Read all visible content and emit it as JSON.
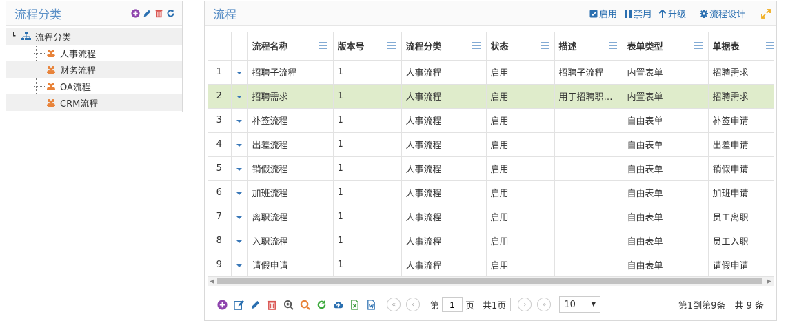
{
  "tree_panel": {
    "title": "流程分类",
    "root": {
      "label": "流程分类"
    },
    "items": [
      {
        "label": "人事流程"
      },
      {
        "label": "财务流程"
      },
      {
        "label": "OA流程"
      },
      {
        "label": "CRM流程"
      }
    ]
  },
  "grid_panel": {
    "title": "流程",
    "actions": {
      "enable": "启用",
      "disable": "禁用",
      "upgrade": "升级",
      "design": "流程设计"
    },
    "columns": [
      "流程名称",
      "版本号",
      "流程分类",
      "状态",
      "描述",
      "表单类型",
      "单据表"
    ],
    "rows": [
      {
        "num": "1",
        "name": "招聘子流程",
        "version": "1",
        "category": "人事流程",
        "status": "启用",
        "desc": "招聘子流程",
        "formtype": "内置表单",
        "table": "招聘需求"
      },
      {
        "num": "2",
        "name": "招聘需求",
        "version": "1",
        "category": "人事流程",
        "status": "启用",
        "desc": "用于招聘职位…",
        "formtype": "内置表单",
        "table": "招聘需求"
      },
      {
        "num": "3",
        "name": "补签流程",
        "version": "1",
        "category": "人事流程",
        "status": "启用",
        "desc": "",
        "formtype": "自由表单",
        "table": "补签申请"
      },
      {
        "num": "4",
        "name": "出差流程",
        "version": "1",
        "category": "人事流程",
        "status": "启用",
        "desc": "",
        "formtype": "自由表单",
        "table": "出差申请"
      },
      {
        "num": "5",
        "name": "销假流程",
        "version": "1",
        "category": "人事流程",
        "status": "启用",
        "desc": "",
        "formtype": "自由表单",
        "table": "销假申请"
      },
      {
        "num": "6",
        "name": "加班流程",
        "version": "1",
        "category": "人事流程",
        "status": "启用",
        "desc": "",
        "formtype": "自由表单",
        "table": "加班申请"
      },
      {
        "num": "7",
        "name": "离职流程",
        "version": "1",
        "category": "人事流程",
        "status": "启用",
        "desc": "",
        "formtype": "自由表单",
        "table": "员工离职"
      },
      {
        "num": "8",
        "name": "入职流程",
        "version": "1",
        "category": "人事流程",
        "status": "启用",
        "desc": "",
        "formtype": "自由表单",
        "table": "员工入职"
      },
      {
        "num": "9",
        "name": "请假申请",
        "version": "1",
        "category": "人事流程",
        "status": "启用",
        "desc": "",
        "formtype": "自由表单",
        "table": "请假申请"
      }
    ],
    "pager": {
      "page_prefix": "第",
      "page_value": "1",
      "page_suffix": "页",
      "total_pages": "共1页",
      "page_size": "10",
      "info": "第1到第9条　共 9 条"
    }
  },
  "colors": {
    "title_blue": "#5a8fc6",
    "link_blue": "#2a6fb0",
    "selected_row": "#dfeccb",
    "tree_icon_orange": "#e8833a"
  }
}
